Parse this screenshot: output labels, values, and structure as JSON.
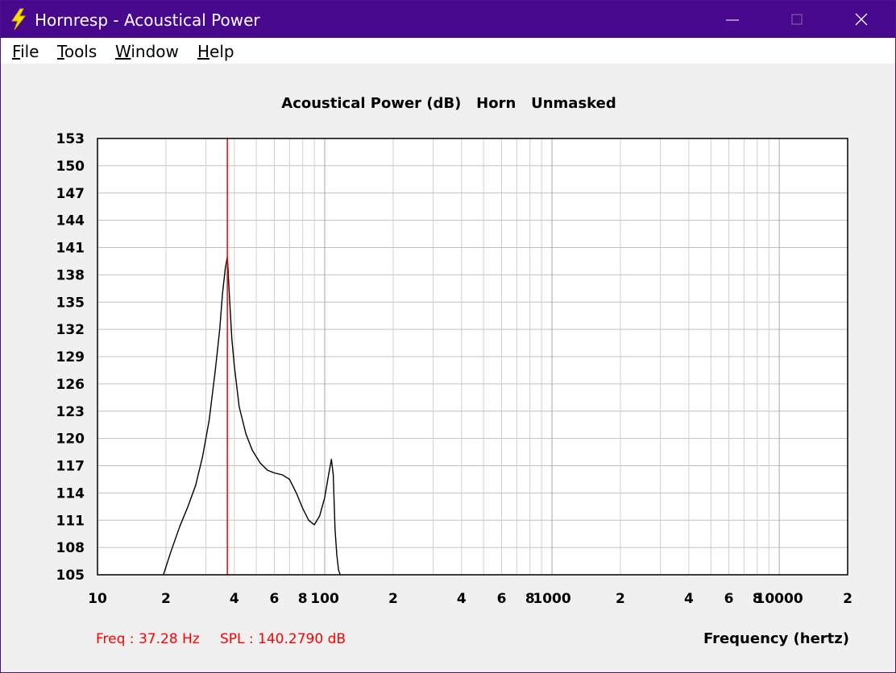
{
  "window": {
    "title": "Hornresp - Acoustical Power"
  },
  "menu": [
    {
      "label": "File",
      "underline": "F",
      "rest": "ile"
    },
    {
      "label": "Tools",
      "underline": "T",
      "rest": "ools"
    },
    {
      "label": "Window",
      "underline": "W",
      "rest": "indow"
    },
    {
      "label": "Help",
      "underline": "H",
      "rest": "elp"
    }
  ],
  "chart_data": {
    "type": "line",
    "title": "Acoustical Power (dB)   Horn   Unmasked",
    "xlabel": "Frequency (hertz)",
    "xscale": "log",
    "xlim": [
      10,
      20000
    ],
    "ylim": [
      105,
      153
    ],
    "yticks": [
      105,
      108,
      111,
      114,
      117,
      120,
      123,
      126,
      129,
      132,
      135,
      138,
      141,
      144,
      147,
      150,
      153
    ],
    "xtick_labels": [
      {
        "value": 10,
        "label": "10"
      },
      {
        "value": 20,
        "label": "2"
      },
      {
        "value": 40,
        "label": "4"
      },
      {
        "value": 60,
        "label": "6"
      },
      {
        "value": 80,
        "label": "8"
      },
      {
        "value": 100,
        "label": "100"
      },
      {
        "value": 200,
        "label": "2"
      },
      {
        "value": 400,
        "label": "4"
      },
      {
        "value": 600,
        "label": "6"
      },
      {
        "value": 800,
        "label": "8"
      },
      {
        "value": 1000,
        "label": "1000"
      },
      {
        "value": 2000,
        "label": "2"
      },
      {
        "value": 4000,
        "label": "4"
      },
      {
        "value": 6000,
        "label": "6"
      },
      {
        "value": 8000,
        "label": "8"
      },
      {
        "value": 10000,
        "label": "10000"
      },
      {
        "value": 20000,
        "label": "2"
      }
    ],
    "grid": true,
    "series": [
      {
        "color": "#000000",
        "x": [
          19.5,
          21,
          23,
          25,
          27,
          29,
          31,
          33,
          34.5,
          35.5,
          36.5,
          37.28,
          38,
          39,
          40,
          42,
          45,
          48,
          52,
          56,
          60,
          65,
          70,
          75,
          80,
          85,
          90,
          95,
          100,
          104,
          107,
          109,
          110,
          111,
          113,
          115,
          117
        ],
        "y": [
          105,
          107.5,
          110.3,
          112.5,
          114.8,
          118,
          122,
          127.5,
          132,
          136,
          138.7,
          140,
          136,
          131,
          128,
          123.5,
          120.5,
          118.7,
          117.3,
          116.5,
          116.2,
          116,
          115.5,
          114,
          112.3,
          111,
          110.5,
          111.5,
          113.5,
          116,
          117.7,
          116,
          113,
          110,
          107.2,
          105.5,
          105
        ]
      }
    ],
    "cursor": {
      "x": 37.28,
      "color": "#ff0000"
    },
    "readout": {
      "freq": "Freq : 37.28 Hz",
      "spl": "SPL : 140.2790 dB",
      "color": "#ff0000"
    }
  }
}
